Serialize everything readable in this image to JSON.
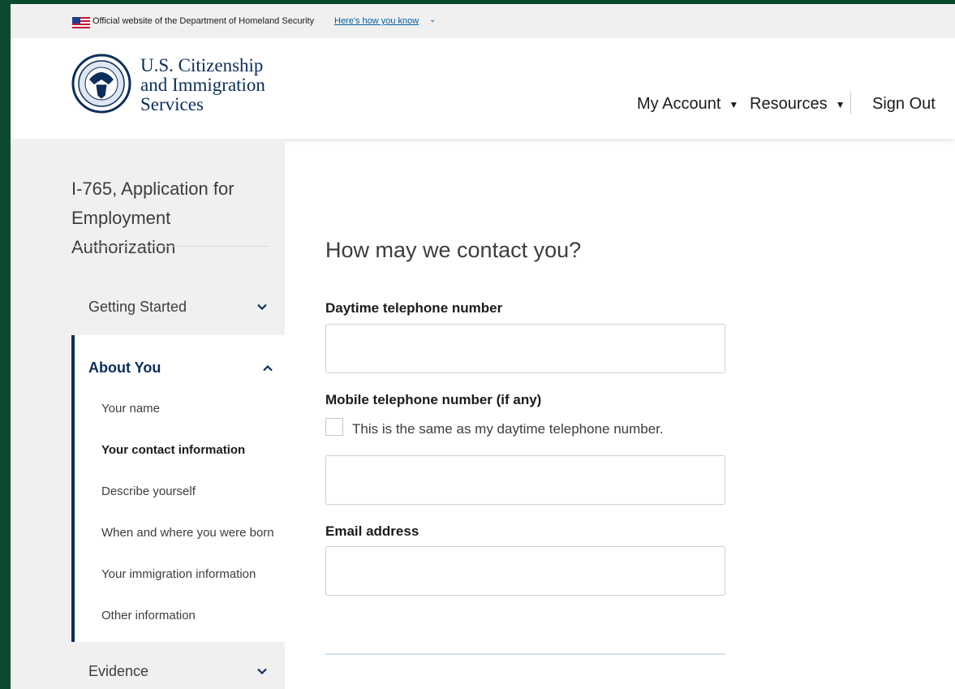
{
  "gov_banner": {
    "text": "Official website of the Department of Homeland Security",
    "link": "Here's how you know"
  },
  "header": {
    "agency_line1": "U.S. Citizenship",
    "agency_line2": "and Immigration",
    "agency_line3": "Services",
    "nav": {
      "my_account": "My Account",
      "resources": "Resources",
      "sign_out": "Sign Out"
    }
  },
  "sidebar": {
    "form_title": "I-765, Application for Employment Authorization",
    "sections": {
      "getting_started": "Getting Started",
      "about_you": "About You",
      "evidence": "Evidence"
    },
    "about_items": [
      "Your name",
      "Your contact information",
      "Describe yourself",
      "When and where you were born",
      "Your immigration information",
      "Other information"
    ],
    "active_item": "Your contact information"
  },
  "form": {
    "heading": "How may we contact you?",
    "daytime_label": "Daytime telephone number",
    "daytime_value": "",
    "mobile_label": "Mobile telephone number (if any)",
    "same_checkbox_label": "This is the same as my daytime telephone number.",
    "same_checked": false,
    "mobile_value": "",
    "email_label": "Email address",
    "email_value": ""
  },
  "colors": {
    "frame_border": "#0b4a2e",
    "navy": "#0b2e5b",
    "banner_bg": "#f0f0f0",
    "link": "#005ea2"
  }
}
